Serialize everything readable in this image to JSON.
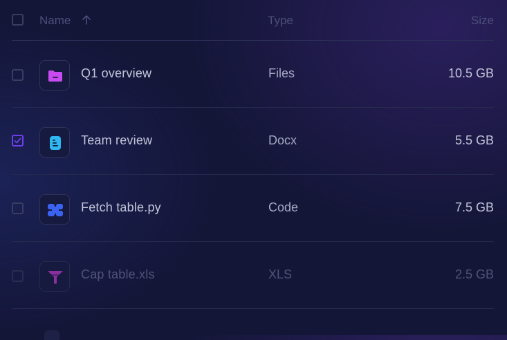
{
  "header": {
    "name_label": "Name",
    "sort_icon": "arrow-up-icon",
    "type_label": "Type",
    "size_label": "Size"
  },
  "files": [
    {
      "name": "Q1 overview",
      "type": "Files",
      "size": "10.5 GB",
      "icon": "folder-icon",
      "icon_color": "#c74bf0",
      "checked": false
    },
    {
      "name": "Team review",
      "type": "Docx",
      "size": "5.5 GB",
      "icon": "document-icon",
      "icon_color": "#2fb8f0",
      "checked": true
    },
    {
      "name": "Fetch table.py",
      "type": "Code",
      "size": "7.5 GB",
      "icon": "code-blocks-icon",
      "icon_color": "#3a63f2",
      "checked": false
    },
    {
      "name": "Cap table.xls",
      "type": "XLS",
      "size": "2.5 GB",
      "icon": "funnel-icon",
      "icon_color": "#8a2fa0",
      "checked": false
    }
  ],
  "colors": {
    "background": "#141638",
    "accent": "#6e3df0",
    "divider": "#26294e"
  }
}
